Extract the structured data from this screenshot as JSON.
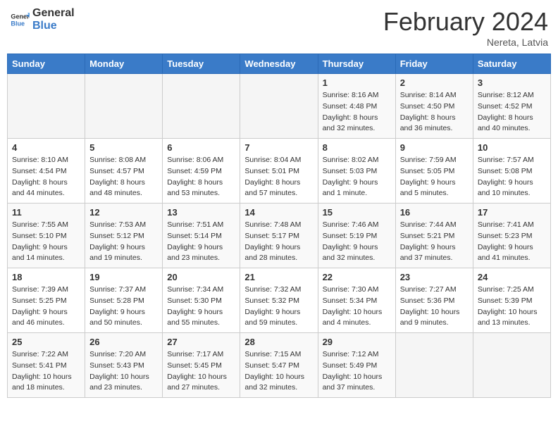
{
  "header": {
    "logo_line1": "General",
    "logo_line2": "Blue",
    "month_year": "February 2024",
    "location": "Nereta, Latvia"
  },
  "days_of_week": [
    "Sunday",
    "Monday",
    "Tuesday",
    "Wednesday",
    "Thursday",
    "Friday",
    "Saturday"
  ],
  "weeks": [
    [
      {
        "day": "",
        "info": ""
      },
      {
        "day": "",
        "info": ""
      },
      {
        "day": "",
        "info": ""
      },
      {
        "day": "",
        "info": ""
      },
      {
        "day": "1",
        "info": "Sunrise: 8:16 AM\nSunset: 4:48 PM\nDaylight: 8 hours\nand 32 minutes."
      },
      {
        "day": "2",
        "info": "Sunrise: 8:14 AM\nSunset: 4:50 PM\nDaylight: 8 hours\nand 36 minutes."
      },
      {
        "day": "3",
        "info": "Sunrise: 8:12 AM\nSunset: 4:52 PM\nDaylight: 8 hours\nand 40 minutes."
      }
    ],
    [
      {
        "day": "4",
        "info": "Sunrise: 8:10 AM\nSunset: 4:54 PM\nDaylight: 8 hours\nand 44 minutes."
      },
      {
        "day": "5",
        "info": "Sunrise: 8:08 AM\nSunset: 4:57 PM\nDaylight: 8 hours\nand 48 minutes."
      },
      {
        "day": "6",
        "info": "Sunrise: 8:06 AM\nSunset: 4:59 PM\nDaylight: 8 hours\nand 53 minutes."
      },
      {
        "day": "7",
        "info": "Sunrise: 8:04 AM\nSunset: 5:01 PM\nDaylight: 8 hours\nand 57 minutes."
      },
      {
        "day": "8",
        "info": "Sunrise: 8:02 AM\nSunset: 5:03 PM\nDaylight: 9 hours\nand 1 minute."
      },
      {
        "day": "9",
        "info": "Sunrise: 7:59 AM\nSunset: 5:05 PM\nDaylight: 9 hours\nand 5 minutes."
      },
      {
        "day": "10",
        "info": "Sunrise: 7:57 AM\nSunset: 5:08 PM\nDaylight: 9 hours\nand 10 minutes."
      }
    ],
    [
      {
        "day": "11",
        "info": "Sunrise: 7:55 AM\nSunset: 5:10 PM\nDaylight: 9 hours\nand 14 minutes."
      },
      {
        "day": "12",
        "info": "Sunrise: 7:53 AM\nSunset: 5:12 PM\nDaylight: 9 hours\nand 19 minutes."
      },
      {
        "day": "13",
        "info": "Sunrise: 7:51 AM\nSunset: 5:14 PM\nDaylight: 9 hours\nand 23 minutes."
      },
      {
        "day": "14",
        "info": "Sunrise: 7:48 AM\nSunset: 5:17 PM\nDaylight: 9 hours\nand 28 minutes."
      },
      {
        "day": "15",
        "info": "Sunrise: 7:46 AM\nSunset: 5:19 PM\nDaylight: 9 hours\nand 32 minutes."
      },
      {
        "day": "16",
        "info": "Sunrise: 7:44 AM\nSunset: 5:21 PM\nDaylight: 9 hours\nand 37 minutes."
      },
      {
        "day": "17",
        "info": "Sunrise: 7:41 AM\nSunset: 5:23 PM\nDaylight: 9 hours\nand 41 minutes."
      }
    ],
    [
      {
        "day": "18",
        "info": "Sunrise: 7:39 AM\nSunset: 5:25 PM\nDaylight: 9 hours\nand 46 minutes."
      },
      {
        "day": "19",
        "info": "Sunrise: 7:37 AM\nSunset: 5:28 PM\nDaylight: 9 hours\nand 50 minutes."
      },
      {
        "day": "20",
        "info": "Sunrise: 7:34 AM\nSunset: 5:30 PM\nDaylight: 9 hours\nand 55 minutes."
      },
      {
        "day": "21",
        "info": "Sunrise: 7:32 AM\nSunset: 5:32 PM\nDaylight: 9 hours\nand 59 minutes."
      },
      {
        "day": "22",
        "info": "Sunrise: 7:30 AM\nSunset: 5:34 PM\nDaylight: 10 hours\nand 4 minutes."
      },
      {
        "day": "23",
        "info": "Sunrise: 7:27 AM\nSunset: 5:36 PM\nDaylight: 10 hours\nand 9 minutes."
      },
      {
        "day": "24",
        "info": "Sunrise: 7:25 AM\nSunset: 5:39 PM\nDaylight: 10 hours\nand 13 minutes."
      }
    ],
    [
      {
        "day": "25",
        "info": "Sunrise: 7:22 AM\nSunset: 5:41 PM\nDaylight: 10 hours\nand 18 minutes."
      },
      {
        "day": "26",
        "info": "Sunrise: 7:20 AM\nSunset: 5:43 PM\nDaylight: 10 hours\nand 23 minutes."
      },
      {
        "day": "27",
        "info": "Sunrise: 7:17 AM\nSunset: 5:45 PM\nDaylight: 10 hours\nand 27 minutes."
      },
      {
        "day": "28",
        "info": "Sunrise: 7:15 AM\nSunset: 5:47 PM\nDaylight: 10 hours\nand 32 minutes."
      },
      {
        "day": "29",
        "info": "Sunrise: 7:12 AM\nSunset: 5:49 PM\nDaylight: 10 hours\nand 37 minutes."
      },
      {
        "day": "",
        "info": ""
      },
      {
        "day": "",
        "info": ""
      }
    ]
  ]
}
